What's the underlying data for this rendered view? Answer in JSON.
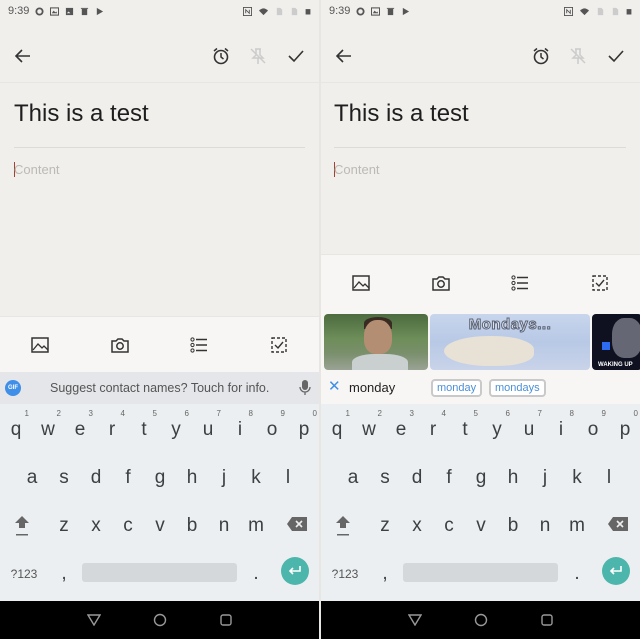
{
  "panels": [
    {
      "status_bar": {
        "time": "9:39",
        "left_icons": [
          "circle-icon",
          "gallery-icon",
          "image-icon",
          "trash-icon",
          "play-store-icon"
        ],
        "right_icons": [
          "nfc-icon",
          "wifi-icon",
          "no-sim-icon",
          "no-sim-icon",
          "battery-icon"
        ]
      },
      "toolbar": {
        "back": "back-arrow-icon",
        "reminder": "alarm-clock-icon",
        "pin": "pin-off-icon",
        "done": "check-icon"
      },
      "note": {
        "title": "This is a test",
        "content_placeholder": "Content"
      },
      "attachments": [
        "image-icon",
        "camera-icon",
        "list-icon",
        "checkbox-icon"
      ],
      "keyboard": {
        "suggestion_badge": "GIF",
        "suggestion_text": "Suggest contact names? Touch for info.",
        "row1": [
          "q",
          "w",
          "e",
          "r",
          "t",
          "y",
          "u",
          "i",
          "o",
          "p"
        ],
        "row1_hints": [
          "1",
          "2",
          "3",
          "4",
          "5",
          "6",
          "7",
          "8",
          "9",
          "0"
        ],
        "row2": [
          "a",
          "s",
          "d",
          "f",
          "g",
          "h",
          "j",
          "k",
          "l"
        ],
        "row3": [
          "z",
          "x",
          "c",
          "v",
          "b",
          "n",
          "m"
        ],
        "symbols_key": "?123",
        "comma": ",",
        "period": "."
      }
    },
    {
      "status_bar": {
        "time": "9:39",
        "left_icons": [
          "circle-icon",
          "gallery-icon",
          "trash-icon",
          "play-store-icon"
        ],
        "right_icons": [
          "nfc-icon",
          "wifi-icon",
          "no-sim-icon",
          "no-sim-icon",
          "battery-icon"
        ]
      },
      "toolbar": {
        "back": "back-arrow-icon",
        "reminder": "alarm-clock-icon",
        "pin": "pin-off-icon",
        "done": "check-icon"
      },
      "note": {
        "title": "This is a test",
        "content_placeholder": "Content"
      },
      "attachments": [
        "image-icon",
        "camera-icon",
        "list-icon",
        "checkbox-icon"
      ],
      "gif_search": {
        "results": [
          {
            "name": "man-looking-gif",
            "caption": ""
          },
          {
            "name": "mondays-bear-gif",
            "caption": "Mondays..."
          },
          {
            "name": "waking-up-gif",
            "caption": "WAKING UP"
          }
        ],
        "query": "monday",
        "chips": [
          "monday",
          "mondays"
        ]
      },
      "keyboard": {
        "row1": [
          "q",
          "w",
          "e",
          "r",
          "t",
          "y",
          "u",
          "i",
          "o",
          "p"
        ],
        "row1_hints": [
          "1",
          "2",
          "3",
          "4",
          "5",
          "6",
          "7",
          "8",
          "9",
          "0"
        ],
        "row2": [
          "a",
          "s",
          "d",
          "f",
          "g",
          "h",
          "j",
          "k",
          "l"
        ],
        "row3": [
          "z",
          "x",
          "c",
          "v",
          "b",
          "n",
          "m"
        ],
        "symbols_key": "?123",
        "comma": ",",
        "period": "."
      }
    }
  ]
}
